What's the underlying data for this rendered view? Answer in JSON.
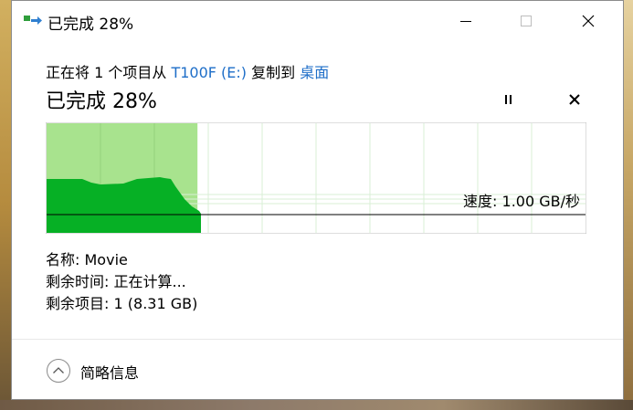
{
  "window": {
    "title": "已完成 28%",
    "buttons": {
      "minimize": "minimize-icon",
      "maximize": "maximize-icon",
      "close": "close-icon"
    }
  },
  "description": {
    "prefix": "正在将 1 个项目从 ",
    "source": "T100F (E:)",
    "middle": " 复制到 ",
    "destination": "桌面"
  },
  "progress": {
    "heading": "已完成 28%",
    "percent": 28,
    "speed_label": "速度: 1.00 GB/秒"
  },
  "details": {
    "name_label": "名称:",
    "name_value": "Movie",
    "time_label": "剩余时间:",
    "time_value": "正在计算...",
    "items_label": "剩余项目:",
    "items_value": "1 (8.31 GB)"
  },
  "footer": {
    "toggle_label": "简略信息"
  },
  "colors": {
    "progress_fill": "#a8e38e",
    "speed_area": "#06b025",
    "grid": "#d8efd6",
    "link": "#1e6ec8"
  }
}
